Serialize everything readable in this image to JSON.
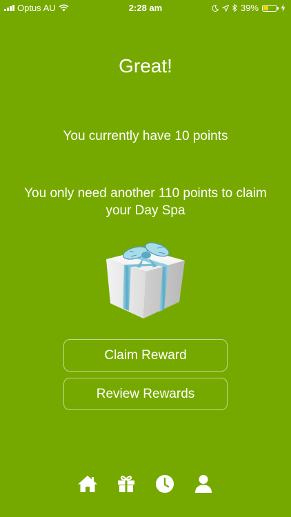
{
  "status_bar": {
    "carrier": "Optus AU",
    "time": "2:28 am",
    "battery_percent": "39%",
    "battery_level": 0.39,
    "icons": [
      "signal-icon",
      "wifi-icon",
      "moon-icon",
      "location-icon",
      "bluetooth-icon",
      "battery-icon",
      "charging-icon"
    ]
  },
  "main": {
    "heading": "Great!",
    "points_current": "You currently have 10 points",
    "points_needed": "You only need another 110 points to claim your Day Spa",
    "gift_image": "gift-box-icon"
  },
  "buttons": {
    "claim_label": "Claim Reward",
    "review_label": "Review Rewards"
  },
  "tab_bar": {
    "items": [
      {
        "icon": "home-icon"
      },
      {
        "icon": "gift-icon"
      },
      {
        "icon": "clock-icon"
      },
      {
        "icon": "user-icon"
      }
    ]
  },
  "colors": {
    "background": "#76a900",
    "text": "#ffffff",
    "battery_fill": "#f5d400"
  }
}
